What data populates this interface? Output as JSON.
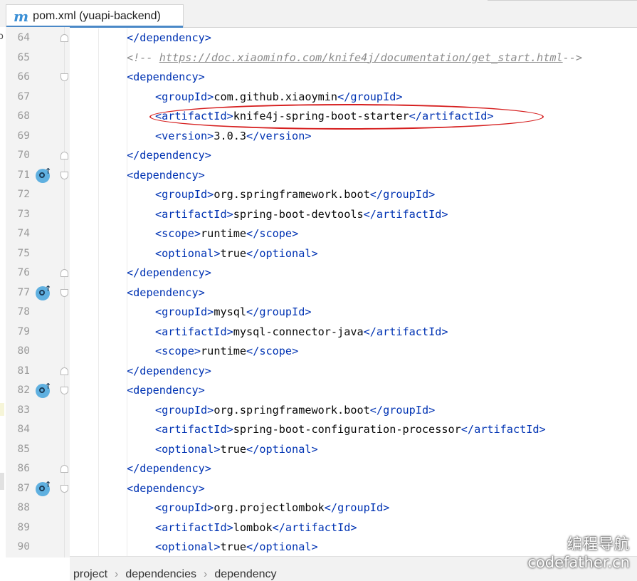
{
  "tab": {
    "title": "pom.xml (yuapi-backend)",
    "icon_letter": "m"
  },
  "left_edge_glyph": "o",
  "lines": [
    {
      "num": "64",
      "indent": 2,
      "parts": [
        [
          "t",
          "</"
        ],
        [
          "t",
          "dependency"
        ],
        [
          "t",
          ">"
        ]
      ],
      "fold": "close"
    },
    {
      "num": "65",
      "indent": 2,
      "comment": true,
      "parts": [
        [
          "c",
          "<!-- "
        ],
        [
          "u",
          "https://doc.xiaominfo.com/knife4j/documentation/get_start.html"
        ],
        [
          "c",
          "-->"
        ]
      ]
    },
    {
      "num": "66",
      "indent": 2,
      "parts": [
        [
          "t",
          "<"
        ],
        [
          "t",
          "dependency"
        ],
        [
          "t",
          ">"
        ]
      ],
      "fold": "open"
    },
    {
      "num": "67",
      "indent": 3,
      "parts": [
        [
          "t",
          "<"
        ],
        [
          "t",
          "groupId"
        ],
        [
          "t",
          ">"
        ],
        [
          "x",
          "com.github.xiaoymin"
        ],
        [
          "t",
          "</"
        ],
        [
          "t",
          "groupId"
        ],
        [
          "t",
          ">"
        ]
      ]
    },
    {
      "num": "68",
      "indent": 3,
      "parts": [
        [
          "t",
          "<"
        ],
        [
          "t",
          "artifactId"
        ],
        [
          "t",
          ">"
        ],
        [
          "x",
          "knife4j-spring-boot-starter"
        ],
        [
          "t",
          "</"
        ],
        [
          "t",
          "artifactId"
        ],
        [
          "t",
          ">"
        ]
      ]
    },
    {
      "num": "69",
      "indent": 3,
      "parts": [
        [
          "t",
          "<"
        ],
        [
          "t",
          "version"
        ],
        [
          "t",
          ">"
        ],
        [
          "x",
          "3.0.3"
        ],
        [
          "t",
          "</"
        ],
        [
          "t",
          "version"
        ],
        [
          "t",
          ">"
        ]
      ]
    },
    {
      "num": "70",
      "indent": 2,
      "parts": [
        [
          "t",
          "</"
        ],
        [
          "t",
          "dependency"
        ],
        [
          "t",
          ">"
        ]
      ],
      "fold": "close"
    },
    {
      "num": "71",
      "indent": 2,
      "parts": [
        [
          "t",
          "<"
        ],
        [
          "t",
          "dependency"
        ],
        [
          "t",
          ">"
        ]
      ],
      "fold": "open",
      "mvn": true
    },
    {
      "num": "72",
      "indent": 3,
      "parts": [
        [
          "t",
          "<"
        ],
        [
          "t",
          "groupId"
        ],
        [
          "t",
          ">"
        ],
        [
          "x",
          "org.springframework.boot"
        ],
        [
          "t",
          "</"
        ],
        [
          "t",
          "groupId"
        ],
        [
          "t",
          ">"
        ]
      ]
    },
    {
      "num": "73",
      "indent": 3,
      "parts": [
        [
          "t",
          "<"
        ],
        [
          "t",
          "artifactId"
        ],
        [
          "t",
          ">"
        ],
        [
          "x",
          "spring-boot-devtools"
        ],
        [
          "t",
          "</"
        ],
        [
          "t",
          "artifactId"
        ],
        [
          "t",
          ">"
        ]
      ]
    },
    {
      "num": "74",
      "indent": 3,
      "parts": [
        [
          "t",
          "<"
        ],
        [
          "t",
          "scope"
        ],
        [
          "t",
          ">"
        ],
        [
          "x",
          "runtime"
        ],
        [
          "t",
          "</"
        ],
        [
          "t",
          "scope"
        ],
        [
          "t",
          ">"
        ]
      ]
    },
    {
      "num": "75",
      "indent": 3,
      "parts": [
        [
          "t",
          "<"
        ],
        [
          "t",
          "optional"
        ],
        [
          "t",
          ">"
        ],
        [
          "x",
          "true"
        ],
        [
          "t",
          "</"
        ],
        [
          "t",
          "optional"
        ],
        [
          "t",
          ">"
        ]
      ]
    },
    {
      "num": "76",
      "indent": 2,
      "parts": [
        [
          "t",
          "</"
        ],
        [
          "t",
          "dependency"
        ],
        [
          "t",
          ">"
        ]
      ],
      "fold": "close"
    },
    {
      "num": "77",
      "indent": 2,
      "parts": [
        [
          "t",
          "<"
        ],
        [
          "t",
          "dependency"
        ],
        [
          "t",
          ">"
        ]
      ],
      "fold": "open",
      "mvn": true
    },
    {
      "num": "78",
      "indent": 3,
      "parts": [
        [
          "t",
          "<"
        ],
        [
          "t",
          "groupId"
        ],
        [
          "t",
          ">"
        ],
        [
          "x",
          "mysql"
        ],
        [
          "t",
          "</"
        ],
        [
          "t",
          "groupId"
        ],
        [
          "t",
          ">"
        ]
      ]
    },
    {
      "num": "79",
      "indent": 3,
      "parts": [
        [
          "t",
          "<"
        ],
        [
          "t",
          "artifactId"
        ],
        [
          "t",
          ">"
        ],
        [
          "x",
          "mysql-connector-java"
        ],
        [
          "t",
          "</"
        ],
        [
          "t",
          "artifactId"
        ],
        [
          "t",
          ">"
        ]
      ]
    },
    {
      "num": "80",
      "indent": 3,
      "parts": [
        [
          "t",
          "<"
        ],
        [
          "t",
          "scope"
        ],
        [
          "t",
          ">"
        ],
        [
          "x",
          "runtime"
        ],
        [
          "t",
          "</"
        ],
        [
          "t",
          "scope"
        ],
        [
          "t",
          ">"
        ]
      ]
    },
    {
      "num": "81",
      "indent": 2,
      "parts": [
        [
          "t",
          "</"
        ],
        [
          "t",
          "dependency"
        ],
        [
          "t",
          ">"
        ]
      ],
      "fold": "close"
    },
    {
      "num": "82",
      "indent": 2,
      "parts": [
        [
          "t",
          "<"
        ],
        [
          "t",
          "dependency"
        ],
        [
          "t",
          ">"
        ]
      ],
      "fold": "open",
      "mvn": true
    },
    {
      "num": "83",
      "indent": 3,
      "parts": [
        [
          "t",
          "<"
        ],
        [
          "t",
          "groupId"
        ],
        [
          "t",
          ">"
        ],
        [
          "x",
          "org.springframework.boot"
        ],
        [
          "t",
          "</"
        ],
        [
          "t",
          "groupId"
        ],
        [
          "t",
          ">"
        ]
      ]
    },
    {
      "num": "84",
      "indent": 3,
      "parts": [
        [
          "t",
          "<"
        ],
        [
          "t",
          "artifactId"
        ],
        [
          "t",
          ">"
        ],
        [
          "x",
          "spring-boot-configuration-processor"
        ],
        [
          "t",
          "</"
        ],
        [
          "t",
          "artifactId"
        ],
        [
          "t",
          ">"
        ]
      ]
    },
    {
      "num": "85",
      "indent": 3,
      "parts": [
        [
          "t",
          "<"
        ],
        [
          "t",
          "optional"
        ],
        [
          "t",
          ">"
        ],
        [
          "x",
          "true"
        ],
        [
          "t",
          "</"
        ],
        [
          "t",
          "optional"
        ],
        [
          "t",
          ">"
        ]
      ]
    },
    {
      "num": "86",
      "indent": 2,
      "parts": [
        [
          "t",
          "</"
        ],
        [
          "t",
          "dependency"
        ],
        [
          "t",
          ">"
        ]
      ],
      "fold": "close"
    },
    {
      "num": "87",
      "indent": 2,
      "parts": [
        [
          "t",
          "<"
        ],
        [
          "t",
          "dependency"
        ],
        [
          "t",
          ">"
        ]
      ],
      "fold": "open",
      "mvn": true
    },
    {
      "num": "88",
      "indent": 3,
      "parts": [
        [
          "t",
          "<"
        ],
        [
          "t",
          "groupId"
        ],
        [
          "t",
          ">"
        ],
        [
          "x",
          "org.projectlombok"
        ],
        [
          "t",
          "</"
        ],
        [
          "t",
          "groupId"
        ],
        [
          "t",
          ">"
        ]
      ]
    },
    {
      "num": "89",
      "indent": 3,
      "parts": [
        [
          "t",
          "<"
        ],
        [
          "t",
          "artifactId"
        ],
        [
          "t",
          ">"
        ],
        [
          "x",
          "lombok"
        ],
        [
          "t",
          "</"
        ],
        [
          "t",
          "artifactId"
        ],
        [
          "t",
          ">"
        ]
      ]
    },
    {
      "num": "90",
      "indent": 3,
      "parts": [
        [
          "t",
          "<"
        ],
        [
          "t",
          "optional"
        ],
        [
          "t",
          ">"
        ],
        [
          "x",
          "true"
        ],
        [
          "t",
          "</"
        ],
        [
          "t",
          "optional"
        ],
        [
          "t",
          ">"
        ]
      ]
    }
  ],
  "breadcrumb": [
    "project",
    "dependencies",
    "dependency"
  ],
  "watermark": {
    "line1": "编程导航",
    "line2": "codefather.cn"
  },
  "colors": {
    "tag": "#0033b3",
    "comment": "#8c8c8c",
    "highlight_ellipse": "#d62020",
    "tab_accent": "#4a88c7"
  }
}
